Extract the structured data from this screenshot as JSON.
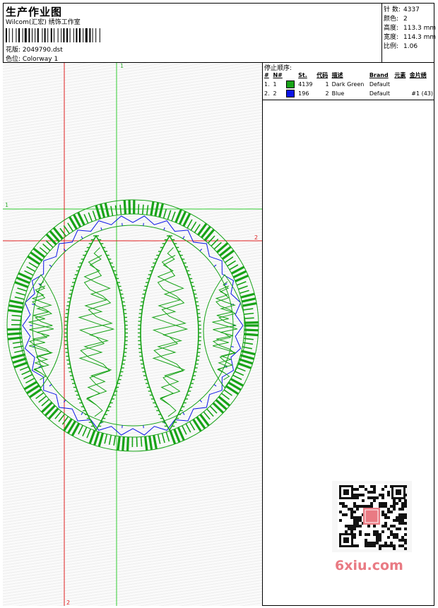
{
  "header": {
    "title": "生产作业图",
    "subtitle": "Wilcom(汇宏) 绣饰工作室",
    "file": "花版: 2049790.dst",
    "colorway": "色位: Colorway 1"
  },
  "stats": {
    "stitches_label": "针 数:",
    "stitches": "4337",
    "colors_label": "颜色:",
    "colors": "2",
    "height_label": "高度:",
    "height": "113.3 mm",
    "width_label": "宽度:",
    "width": "114.3 mm",
    "scale_label": "比例:",
    "scale": "1.06"
  },
  "stop_sequence": {
    "title": "停止顺序:",
    "headers": [
      "#",
      "N#",
      "St.",
      "代码",
      "描述",
      "Brand",
      "元素",
      "金片绣"
    ],
    "rows": [
      {
        "num": "1.",
        "n": "1",
        "color": "#17a317",
        "st": "4139",
        "code": "1",
        "desc": "Dark Green",
        "brand": "Default",
        "element": "",
        "sequin": ""
      },
      {
        "num": "2.",
        "n": "2",
        "color": "#0a14e6",
        "st": "196",
        "code": "2",
        "desc": "Blue",
        "brand": "Default",
        "element": "",
        "sequin": "#1 (43)"
      }
    ]
  },
  "guides": {
    "v1_label": "1",
    "h1_label": "1",
    "h2_label": "2",
    "v2_label": "2"
  },
  "design": {
    "green": "#17a317",
    "blue": "#0a14e6",
    "guide_green": "#33cc33",
    "guide_red": "#e02020"
  },
  "watermark": {
    "brand": "6xiu.com"
  }
}
